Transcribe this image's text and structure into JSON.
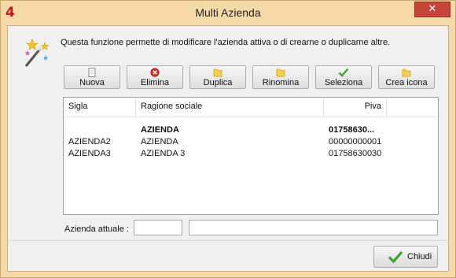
{
  "window": {
    "title": "Multi Azienda",
    "app_icon": "4",
    "close_glyph": "✕"
  },
  "description": "Questa funzione permette di modificare l'azienda attiva  o di crearne o duplicarne altre.",
  "toolbar": {
    "nuova": "Nuova",
    "elimina": "Elimina",
    "duplica": "Duplica",
    "rinomina": "Rinomina",
    "seleziona": "Seleziona",
    "crea_icona": "Crea icona"
  },
  "grid": {
    "headers": {
      "sigla": "Sigla",
      "ragione": "Ragione sociale",
      "piva": "Piva"
    },
    "rows": [
      {
        "sigla": "",
        "ragione": "AZIENDA",
        "piva": "01758630..."
      },
      {
        "sigla": "AZIENDA2",
        "ragione": "AZIENDA",
        "piva": "00000000001"
      },
      {
        "sigla": "AZIENDA3",
        "ragione": "AZIENDA 3",
        "piva": "01758630030"
      }
    ]
  },
  "current": {
    "label": "Azienda attuale :",
    "code_value": "",
    "name_value": ""
  },
  "footer": {
    "close_label": "Chiudi"
  },
  "colors": {
    "frame": "#f5d9a6",
    "close_red": "#c7443a",
    "client": "#f0f0f0"
  }
}
